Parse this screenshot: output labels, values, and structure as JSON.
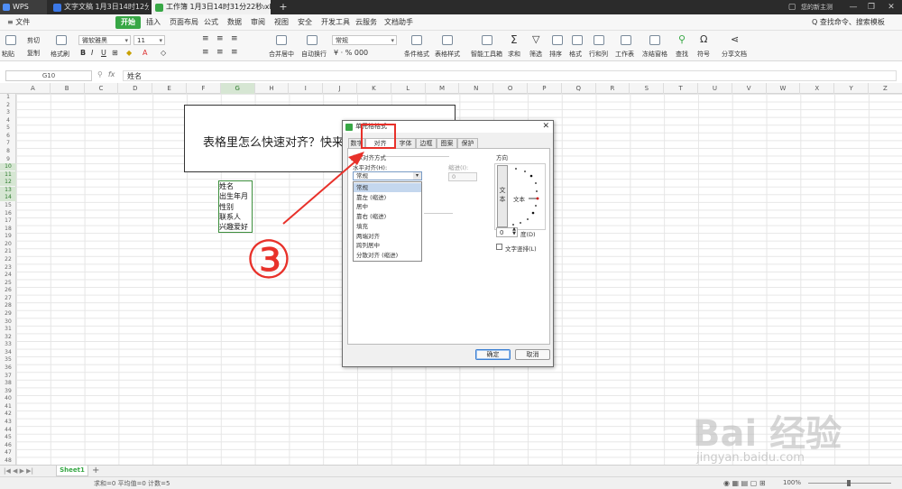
{
  "window": {
    "app_name": "WPS",
    "tabs": [
      {
        "label": "文字文稿 1月3日14时12分42秒",
        "color": "#3b78e7"
      },
      {
        "label": "工作簿 1月3日14时31分22秒.xlsx",
        "color": "#37a745"
      }
    ],
    "new_tab": "+",
    "login_text": "您的新主测"
  },
  "menubar": {
    "file": "≡ 文件",
    "items": [
      "开始",
      "插入",
      "页面布局",
      "公式",
      "数据",
      "审阅",
      "视图",
      "安全",
      "开发工具",
      "云服务",
      "文档助手"
    ],
    "search": "Q 查找命令、搜索模板"
  },
  "ribbon": {
    "cut": "剪切",
    "copy": "复制",
    "paste": "粘贴",
    "format_painter": "格式刷",
    "font_name": "微软雅黑",
    "font_size": "11",
    "number_format": "常规",
    "merge_center": "合并居中",
    "wrap": "自动换行",
    "cond_format": "条件格式",
    "table_style": "表格样式",
    "smart_tools": "智能工具箱",
    "sum": "求和",
    "filter": "筛选",
    "sort": "排序",
    "format": "格式",
    "row_col": "行和列",
    "worksheet": "工作表",
    "freeze": "冻结窗格",
    "find": "查找",
    "symbol": "符号",
    "share": "分享文档"
  },
  "formula_bar": {
    "name_box": "G10",
    "fx": "fx",
    "value": "姓名"
  },
  "columns": [
    "A",
    "B",
    "C",
    "D",
    "E",
    "F",
    "G",
    "H",
    "I",
    "J",
    "K",
    "L",
    "M",
    "N",
    "O",
    "P",
    "Q",
    "R",
    "S",
    "T",
    "U",
    "V",
    "W",
    "X",
    "Y",
    "Z"
  ],
  "rows": [
    "1",
    "2",
    "3",
    "4",
    "5",
    "6",
    "7",
    "8",
    "9",
    "10",
    "11",
    "12",
    "13",
    "14",
    "15",
    "16",
    "17",
    "18",
    "19",
    "20",
    "21",
    "22",
    "23",
    "24",
    "25",
    "26",
    "27",
    "28",
    "29",
    "30",
    "31",
    "32",
    "33",
    "34",
    "35",
    "36",
    "37",
    "38",
    "39",
    "40",
    "41",
    "42",
    "43",
    "44",
    "45",
    "46",
    "47",
    "48"
  ],
  "selected_column": "G",
  "selected_rows": [
    "10",
    "11",
    "12",
    "13",
    "14"
  ],
  "textbox": "表格里怎么快速对齐？快来试",
  "cells": [
    "姓名",
    "出生年月",
    "性别",
    "联系人",
    "兴趣爱好"
  ],
  "dialog": {
    "title": "单元格格式",
    "close": "✕",
    "tabs": [
      "数字",
      "对齐",
      "字体",
      "边框",
      "图案",
      "保护"
    ],
    "active_tab": "对齐",
    "section_text_align": "文本对齐方式",
    "horizontal_label": "水平对齐(H):",
    "horizontal_value": "常规",
    "indent_label": "缩进(I):",
    "indent_value": "0",
    "dropdown_options": [
      "常规",
      "靠左 (缩进)",
      "居中",
      "靠右 (缩进)",
      "填充",
      "两端对齐",
      "跨列居中",
      "分散对齐 (缩进)"
    ],
    "highlighted_option": "常规",
    "orientation_label": "方向",
    "vertical_text": "文本",
    "dial_text": "文本",
    "degrees_value": "0",
    "degrees_label": "度(D)",
    "vertical_text_checkbox": "文字竖排(L)",
    "ok": "确定",
    "cancel": "取消"
  },
  "annotation": {
    "number": "③",
    "color": "#e8312a"
  },
  "sheetbar": {
    "sheet": "Sheet1",
    "add": "+"
  },
  "statusbar": {
    "stats": "求和=0  平均值=0  计数=5",
    "zoom": "100%"
  },
  "watermark": {
    "text": "Bai 经验",
    "url": "jingyan.baidu.com"
  }
}
